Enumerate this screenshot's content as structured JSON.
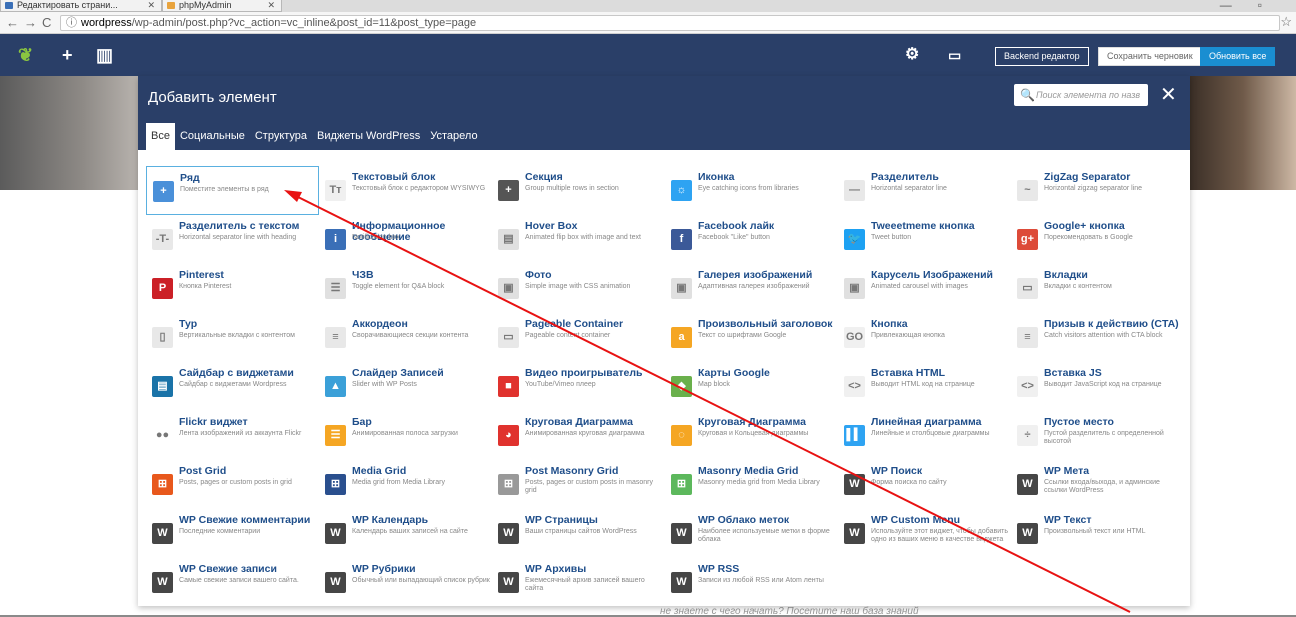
{
  "browser": {
    "tabs": [
      {
        "title": "Редактировать страни..."
      },
      {
        "title": "phpMyAdmin"
      }
    ],
    "url_host": "wordpress",
    "url_path": "/wp-admin/post.php?vc_action=vc_inline&post_id=11&post_type=page"
  },
  "vc_toolbar": {
    "backend_label": "Backend редактор",
    "draft_label": "Сохранить черновик",
    "update_label": "Обновить все"
  },
  "panel": {
    "title": "Добавить элемент",
    "search_placeholder": "Поиск элемента по назв",
    "tabs": [
      "Все",
      "Социальные",
      "Структура",
      "Виджеты WordPress",
      "Устарело"
    ],
    "elements": [
      {
        "title": "Ряд",
        "desc": "Поместите элементы в ряд",
        "icon": "plus-icon",
        "color": "#4a90d9",
        "glyph": "+"
      },
      {
        "title": "Текстовый блок",
        "desc": "Текстовый блок с редактором WYSIWYG",
        "icon": "text-icon",
        "color": "#f0f0f0",
        "glyph": "Tт"
      },
      {
        "title": "Секция",
        "desc": "Group multiple rows in section",
        "icon": "section-icon",
        "color": "#555",
        "glyph": "+"
      },
      {
        "title": "Иконка",
        "desc": "Eye catching icons from libraries",
        "icon": "sun-icon",
        "color": "#2ea3f2",
        "glyph": "☼"
      },
      {
        "title": "Разделитель",
        "desc": "Horizontal separator line",
        "icon": "separator-icon",
        "color": "#e8e8e8",
        "glyph": "—"
      },
      {
        "title": "ZigZag Separator",
        "desc": "Horizontal zigzag separator line",
        "icon": "zigzag-icon",
        "color": "#e8e8e8",
        "glyph": "~"
      },
      {
        "title": "Разделитель с текстом",
        "desc": "Horizontal separator line with heading",
        "icon": "text-separator-icon",
        "color": "#e8e8e8",
        "glyph": "-T-"
      },
      {
        "title": "Информационное сообщение",
        "desc": "Notification box",
        "icon": "info-icon",
        "color": "#3a6fb7",
        "glyph": "i"
      },
      {
        "title": "Hover Box",
        "desc": "Animated flip box with image and text",
        "icon": "hover-box-icon",
        "color": "#e0e0e0",
        "glyph": "▤"
      },
      {
        "title": "Facebook лайк",
        "desc": "Facebook \"Like\" button",
        "icon": "facebook-icon",
        "color": "#3b5998",
        "glyph": "f"
      },
      {
        "title": "Tweeetmeme кнопка",
        "desc": "Tweet button",
        "icon": "twitter-icon",
        "color": "#1da1f2",
        "glyph": "🐦"
      },
      {
        "title": "Google+ кнопка",
        "desc": "Порекомендовать в Google",
        "icon": "google-plus-icon",
        "color": "#dd4b39",
        "glyph": "g+"
      },
      {
        "title": "Pinterest",
        "desc": "Кнопка Pinterest",
        "icon": "pinterest-icon",
        "color": "#cb2027",
        "glyph": "P"
      },
      {
        "title": "ЧЗВ",
        "desc": "Toggle element for Q&A block",
        "icon": "faq-icon",
        "color": "#e0e0e0",
        "glyph": "☰"
      },
      {
        "title": "Фото",
        "desc": "Simple image with CSS animation",
        "icon": "image-icon",
        "color": "#e0e0e0",
        "glyph": "▣"
      },
      {
        "title": "Галерея изображений",
        "desc": "Адаптивная галерея изображений",
        "icon": "gallery-icon",
        "color": "#e0e0e0",
        "glyph": "▣"
      },
      {
        "title": "Карусель Изображений",
        "desc": "Animated carousel with images",
        "icon": "carousel-icon",
        "color": "#e0e0e0",
        "glyph": "▣"
      },
      {
        "title": "Вкладки",
        "desc": "Вкладки с контентом",
        "icon": "tabs-icon",
        "color": "#e8e8e8",
        "glyph": "▭"
      },
      {
        "title": "Тур",
        "desc": "Вертикальные вкладки с контентом",
        "icon": "tour-icon",
        "color": "#e8e8e8",
        "glyph": "▯"
      },
      {
        "title": "Аккордеон",
        "desc": "Сворачивающиеся секции контента",
        "icon": "accordion-icon",
        "color": "#e8e8e8",
        "glyph": "≡"
      },
      {
        "title": "Pageable Container",
        "desc": "Pageable content container",
        "icon": "pageable-icon",
        "color": "#e8e8e8",
        "glyph": "▭"
      },
      {
        "title": "Произвольный заголовок",
        "desc": "Текст со шрифтами Google",
        "icon": "custom-heading-icon",
        "color": "#f5a623",
        "glyph": "a"
      },
      {
        "title": "Кнопка",
        "desc": "Привлекающая кнопка",
        "icon": "button-icon",
        "color": "#f0f0f0",
        "glyph": "GO"
      },
      {
        "title": "Призыв к действию (CTA)",
        "desc": "Catch visitors attention with CTA block",
        "icon": "cta-icon",
        "color": "#e8e8e8",
        "glyph": "≡"
      },
      {
        "title": "Сайдбар с виджетами",
        "desc": "Сайдбар с виджетами Wordpress",
        "icon": "sidebar-icon",
        "color": "#1a73a8",
        "glyph": "▤"
      },
      {
        "title": "Слайдер Записей",
        "desc": "Slider with WP Posts",
        "icon": "post-slider-icon",
        "color": "#3ba0d8",
        "glyph": "▲"
      },
      {
        "title": "Видео проигрыватель",
        "desc": "YouTube/Vimeo плеер",
        "icon": "video-icon",
        "color": "#e0322e",
        "glyph": "■"
      },
      {
        "title": "Карты Google",
        "desc": "Map block",
        "icon": "map-icon",
        "color": "#6ab04c",
        "glyph": "◆"
      },
      {
        "title": "Вставка HTML",
        "desc": "Выводит HTML код на странице",
        "icon": "html-icon",
        "color": "#f0f0f0",
        "glyph": "<>"
      },
      {
        "title": "Вставка JS",
        "desc": "Выводит JavaScript код на странице",
        "icon": "js-icon",
        "color": "#f0f0f0",
        "glyph": "<>"
      },
      {
        "title": "Flickr виджет",
        "desc": "Лента изображений из аккаунта Flickr",
        "icon": "flickr-icon",
        "color": "#ffffff",
        "glyph": "●●"
      },
      {
        "title": "Бар",
        "desc": "Анимированная полоса загрузки",
        "icon": "progress-bar-icon",
        "color": "#f5a623",
        "glyph": "☰"
      },
      {
        "title": "Круговая Диаграмма",
        "desc": "Анимированная круговая диаграмма",
        "icon": "pie-chart-icon",
        "color": "#e0322e",
        "glyph": "◕"
      },
      {
        "title": "Круговая Диаграмма",
        "desc": "Круговая и Кольцевая диаграммы",
        "icon": "donut-chart-icon",
        "color": "#f5a623",
        "glyph": "◌"
      },
      {
        "title": "Линейная диаграмма",
        "desc": "Линейные и столбцовые диаграммы",
        "icon": "line-chart-icon",
        "color": "#2ea3f2",
        "glyph": "▌▍"
      },
      {
        "title": "Пустое место",
        "desc": "Пустой разделитель с определенной высотой",
        "icon": "spacer-icon",
        "color": "#f0f0f0",
        "glyph": "÷"
      },
      {
        "title": "Post Grid",
        "desc": "Posts, pages or custom posts in grid",
        "icon": "post-grid-icon",
        "color": "#e8581c",
        "glyph": "⊞"
      },
      {
        "title": "Media Grid",
        "desc": "Media grid from Media Library",
        "icon": "media-grid-icon",
        "color": "#2a4f8e",
        "glyph": "⊞"
      },
      {
        "title": "Post Masonry Grid",
        "desc": "Posts, pages or custom posts in masonry grid",
        "icon": "masonry-grid-icon",
        "color": "#999",
        "glyph": "⊞"
      },
      {
        "title": "Masonry Media Grid",
        "desc": "Masonry media grid from Media Library",
        "icon": "masonry-media-icon",
        "color": "#5cb85c",
        "glyph": "⊞"
      },
      {
        "title": "WP Поиск",
        "desc": "Форма поиска по сайту",
        "icon": "wordpress-icon",
        "color": "#464646",
        "glyph": "W"
      },
      {
        "title": "WP Мета",
        "desc": "Ссылки входа/выхода, и админские ссылки WordPress",
        "icon": "wordpress-icon",
        "color": "#464646",
        "glyph": "W"
      },
      {
        "title": "WP Свежие комментарии",
        "desc": "Последние комментарии",
        "icon": "wordpress-icon",
        "color": "#464646",
        "glyph": "W"
      },
      {
        "title": "WP Календарь",
        "desc": "Календарь ваших записей на сайте",
        "icon": "wordpress-icon",
        "color": "#464646",
        "glyph": "W"
      },
      {
        "title": "WP Страницы",
        "desc": "Ваши страницы сайтов WordPress",
        "icon": "wordpress-icon",
        "color": "#464646",
        "glyph": "W"
      },
      {
        "title": "WP Облако меток",
        "desc": "Наиболее используемые метки в форме облака",
        "icon": "wordpress-icon",
        "color": "#464646",
        "glyph": "W"
      },
      {
        "title": "WP Custom Menu",
        "desc": "Используйте этот виджет, чтобы добавить одно из ваших меню в качестве виджета",
        "icon": "wordpress-icon",
        "color": "#464646",
        "glyph": "W"
      },
      {
        "title": "WP Текст",
        "desc": "Произвольный текст или HTML",
        "icon": "wordpress-icon",
        "color": "#464646",
        "glyph": "W"
      },
      {
        "title": "WP Свежие записи",
        "desc": "Самые свежие записи вашего сайта.",
        "icon": "wordpress-icon",
        "color": "#464646",
        "glyph": "W"
      },
      {
        "title": "WP Рубрики",
        "desc": "Обычный или выпадающий список рубрик",
        "icon": "wordpress-icon",
        "color": "#464646",
        "glyph": "W"
      },
      {
        "title": "WP Архивы",
        "desc": "Ежемесячный архив записей вашего сайта",
        "icon": "wordpress-icon",
        "color": "#464646",
        "glyph": "W"
      },
      {
        "title": "WP RSS",
        "desc": "Записи из любой RSS или Atom ленты",
        "icon": "wordpress-icon",
        "color": "#464646",
        "glyph": "W"
      }
    ]
  },
  "footer_hint": "не знаете с чего начать? Посетите наш база знаний"
}
